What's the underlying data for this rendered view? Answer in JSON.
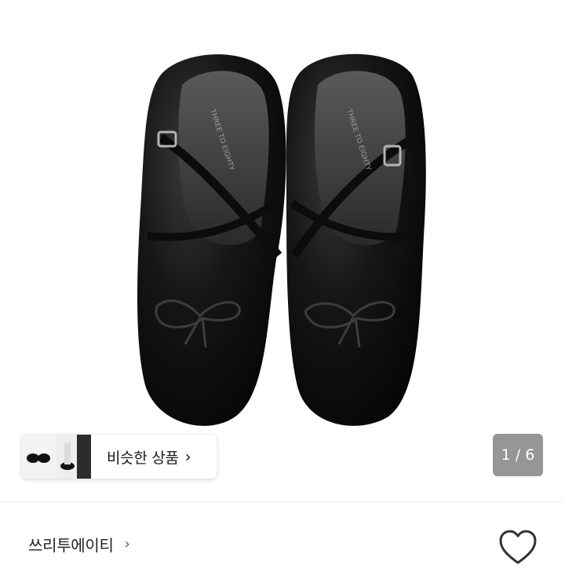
{
  "product": {
    "image_icon": "black-satin-mary-jane-shoes-photo",
    "insole_text": "THREE TO EIGHTY"
  },
  "similar": {
    "label": "비슷한 상품",
    "chevron": "›"
  },
  "pager": {
    "text": "1 / 6",
    "current": 1,
    "total": 6
  },
  "shop": {
    "name": "쓰리투에이티",
    "chevron": "›"
  },
  "favorite": {
    "icon": "heart-outline-icon"
  },
  "colors": {
    "shoe": "#141414",
    "chip_bg": "#ffffff",
    "counter_bg": "#7a7a7a"
  }
}
